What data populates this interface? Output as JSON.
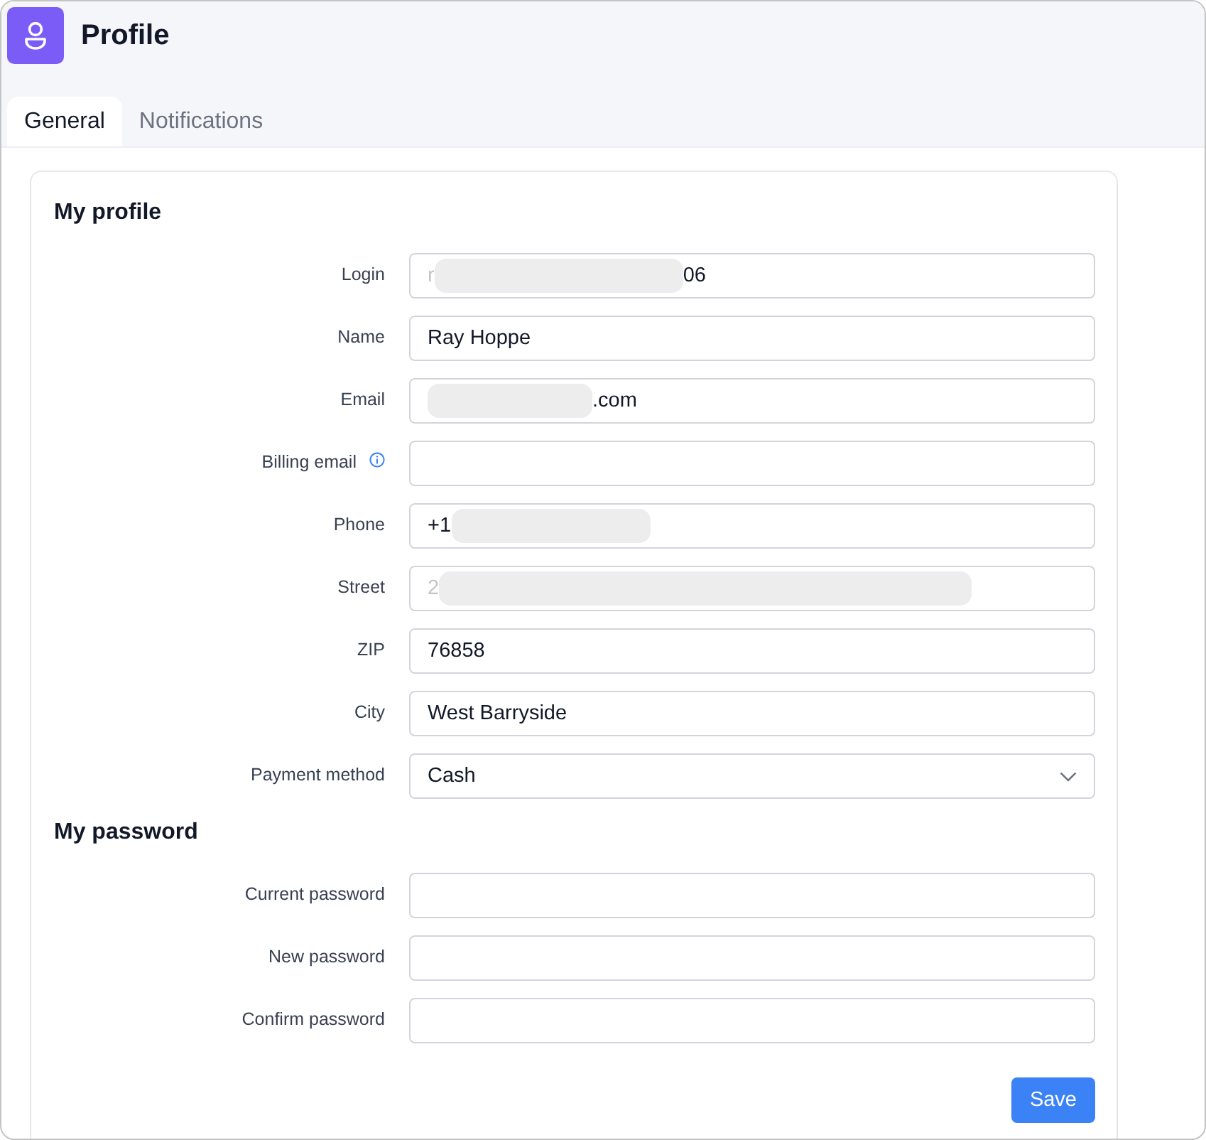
{
  "header": {
    "title": "Profile"
  },
  "tabs": [
    {
      "label": "General",
      "selected": true
    },
    {
      "label": "Notifications",
      "selected": false
    }
  ],
  "profile": {
    "heading": "My profile",
    "fields": [
      {
        "label": "Login",
        "kind": "text",
        "info": false,
        "blurred": true,
        "value_start": "r",
        "value_end": "06"
      },
      {
        "label": "Name",
        "kind": "text",
        "info": false,
        "blurred": false,
        "value_start": "Ray Hoppe"
      },
      {
        "label": "Email",
        "kind": "text",
        "info": false,
        "blurred": true,
        "value_end": ".com"
      },
      {
        "label": "Billing email",
        "kind": "text",
        "info": true,
        "blurred": false
      },
      {
        "label": "Phone",
        "kind": "text",
        "info": false,
        "blurred": true,
        "value_start": "+1"
      },
      {
        "label": "Street",
        "kind": "text",
        "info": false,
        "blurred": true,
        "value_start": "2"
      },
      {
        "label": "ZIP",
        "kind": "text",
        "info": false,
        "blurred": false,
        "value_start": "76858"
      },
      {
        "label": "City",
        "kind": "text",
        "info": false,
        "blurred": false,
        "value_start": "West Barryside"
      },
      {
        "label": "Payment method",
        "kind": "select",
        "info": false,
        "blurred": false,
        "value_start": "Cash"
      }
    ]
  },
  "password": {
    "heading": "My password",
    "fields": [
      {
        "label": "Current password",
        "kind": "password"
      },
      {
        "label": "New password",
        "kind": "password"
      },
      {
        "label": "Confirm password",
        "kind": "password"
      }
    ]
  },
  "save_button": "Save"
}
